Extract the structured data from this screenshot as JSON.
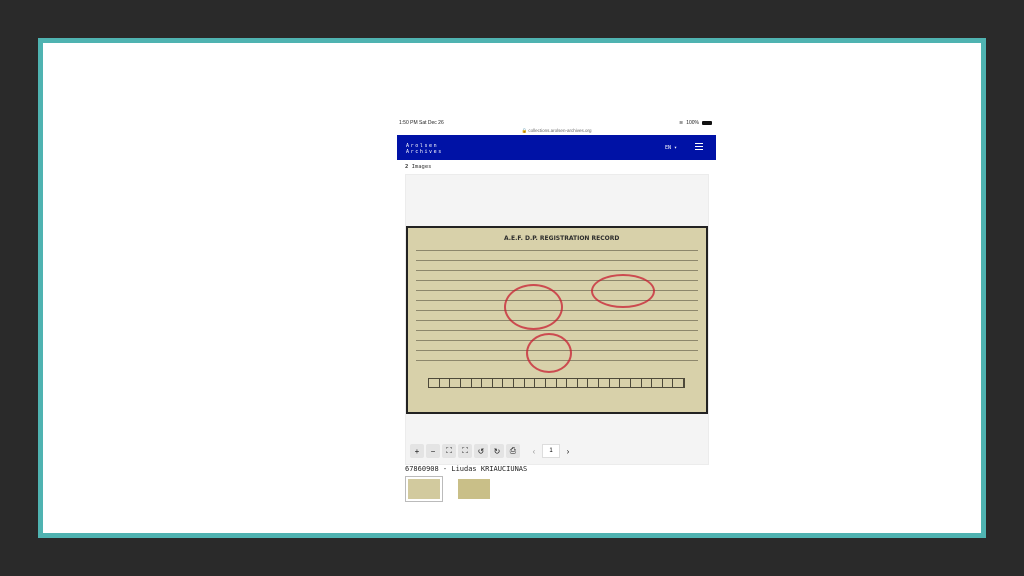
{
  "status_bar": {
    "time": "1:50 PM  Sat Dec 26",
    "battery": "100%"
  },
  "browser": {
    "url": "collections.arolsen-archives.org"
  },
  "header": {
    "logo_line1": "Arolsen",
    "logo_line2": "Archives",
    "language": "EN ▾"
  },
  "viewer": {
    "image_count": "2",
    "image_count_label": "Images",
    "document_title": "A.E.F. D.P. REGISTRATION RECORD",
    "toolbar": {
      "zoom_in": "+",
      "zoom_out": "−",
      "fit": "⛶",
      "actual_size": "⛶",
      "rotate_left": "↺",
      "rotate_right": "↻",
      "print": "⎙",
      "prev": "‹",
      "page": "1",
      "next": "›"
    },
    "caption": "67860908 - Liudas KRIAUCIUNAS"
  }
}
